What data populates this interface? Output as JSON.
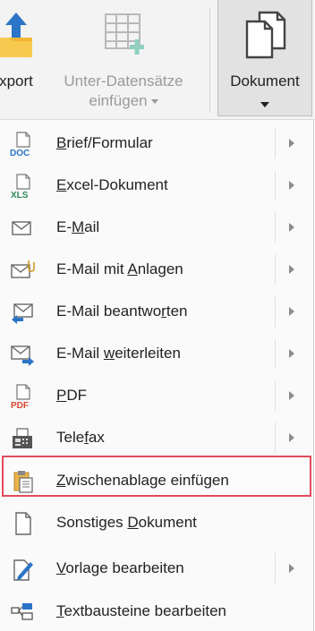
{
  "ribbon": {
    "export_label": "xport",
    "unter_label_1": "Unter-Datensätze",
    "unter_label_2": "einfügen",
    "dokument_label": "Dokument"
  },
  "menu": {
    "items": [
      {
        "pre": "",
        "u": "B",
        "post": "rief/Formular",
        "icon": "doc-icon",
        "submenu": true
      },
      {
        "pre": "",
        "u": "E",
        "post": "xcel-Dokument",
        "icon": "xls-icon",
        "submenu": true
      },
      {
        "pre": "E-",
        "u": "M",
        "post": "ail",
        "icon": "mail-icon",
        "submenu": true
      },
      {
        "pre": "E-Mail mit ",
        "u": "A",
        "post": "nlagen",
        "icon": "mail-attachment-icon",
        "submenu": true
      },
      {
        "pre": "E-Mail beantwo",
        "u": "r",
        "post": "ten",
        "icon": "mail-reply-icon",
        "submenu": true
      },
      {
        "pre": "E-Mail ",
        "u": "w",
        "post": "eiterleiten",
        "icon": "mail-forward-icon",
        "submenu": true
      },
      {
        "pre": "",
        "u": "P",
        "post": "DF",
        "icon": "pdf-icon",
        "submenu": true
      },
      {
        "pre": "Tele",
        "u": "f",
        "post": "ax",
        "icon": "fax-icon",
        "submenu": true
      },
      {
        "pre": "",
        "u": "Z",
        "post": "wischenablage einfügen",
        "icon": "clipboard-icon",
        "submenu": false
      },
      {
        "pre": "Sonstiges ",
        "u": "D",
        "post": "okument",
        "icon": "blank-document-icon",
        "submenu": false
      },
      {
        "pre": "",
        "u": "V",
        "post": "orlage bearbeiten",
        "icon": "edit-template-icon",
        "submenu": true
      },
      {
        "pre": "",
        "u": "T",
        "post": "extbausteine bearbeiten",
        "icon": "text-blocks-icon",
        "submenu": false
      }
    ]
  },
  "colors": {
    "highlight_border": "#e04c5c",
    "accent_blue": "#2b74c7",
    "pdf_red": "#d9442f",
    "xls_green": "#2e8b57"
  }
}
